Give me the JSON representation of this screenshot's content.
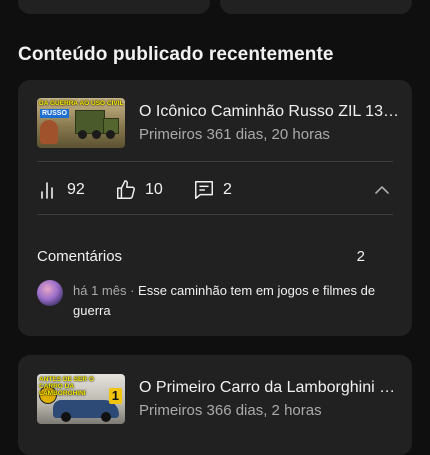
{
  "section": {
    "title": "Conteúdo publicado recentemente"
  },
  "videos": [
    {
      "title": "O Icônico Caminhão Russo ZIL 131...",
      "subtitle": "Primeiros 361 dias, 20 horas",
      "thumbnail_text": "DA GUERRA AO USO CIVIL",
      "thumbnail_badge": "RUSSO",
      "stats": {
        "views": "92",
        "likes": "10",
        "comments": "2"
      },
      "comments_section": {
        "label": "Comentários",
        "count": "2",
        "latest": {
          "time": "há 1 mês",
          "separator": " · ",
          "text": "Esse caminhão tem em jogos e filmes de guerra"
        }
      }
    },
    {
      "title": "O Primeiro Carro da Lamborghini o ...",
      "subtitle": "Primeiros 366 dias, 2 horas",
      "thumbnail_text": "ANTES DE SER O CARRO DA LAMBORGHINI",
      "thumbnail_badge": "1"
    }
  ],
  "icons": {
    "views": "bar-chart-icon",
    "likes": "thumb-up-icon",
    "comments": "comment-icon",
    "collapse": "chevron-up-icon"
  },
  "colors": {
    "background": "#0f0f0f",
    "card": "#212121",
    "text_primary": "#f1f1f1",
    "text_secondary": "#aaaaaa"
  }
}
